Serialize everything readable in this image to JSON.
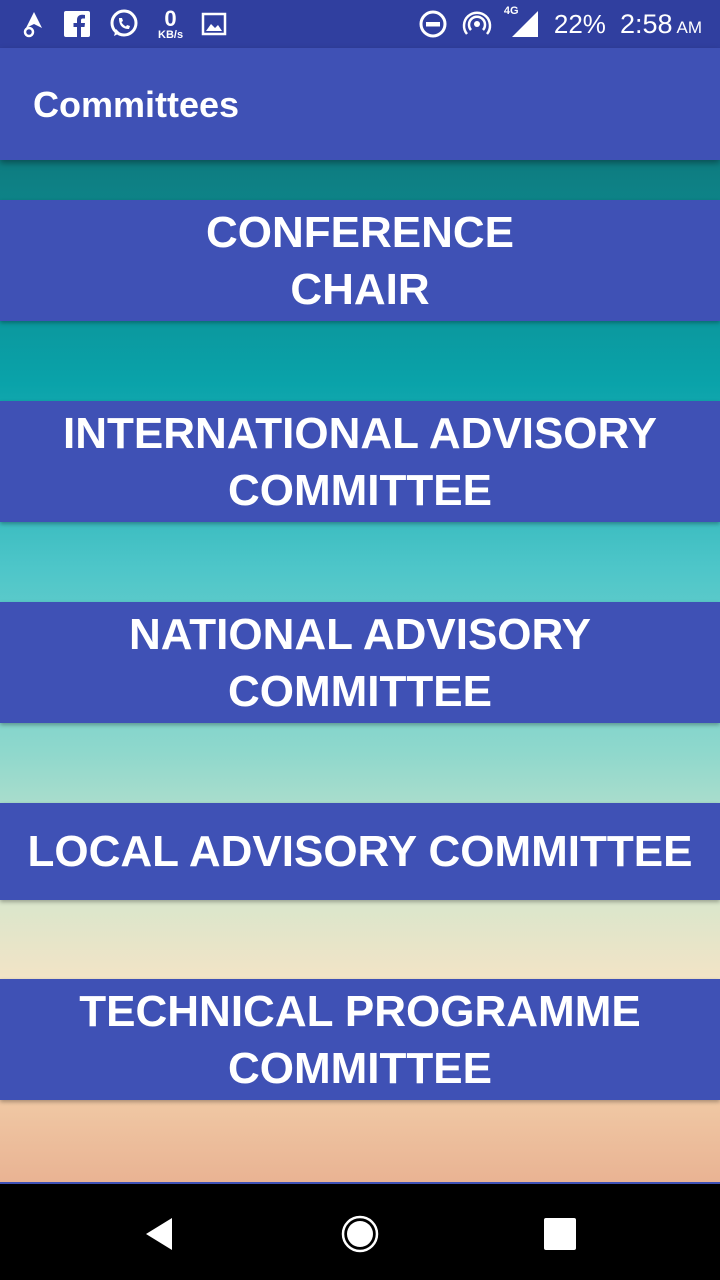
{
  "status_bar": {
    "left_icons": [
      "navigation-icon",
      "facebook-icon",
      "whatsapp-icon",
      "network-speed-icon",
      "gallery-icon"
    ],
    "network_speed_value": "0",
    "network_speed_unit": "KB/s",
    "network_type": "4G",
    "battery": "22%",
    "time": "2:58",
    "ampm": "AM"
  },
  "app_bar": {
    "title": "Committees"
  },
  "committees": [
    {
      "line1": "CONFERENCE",
      "line2": "CHAIR"
    },
    {
      "line1": "INTERNATIONAL ADVISORY",
      "line2": "COMMITTEE"
    },
    {
      "line1": "NATIONAL ADVISORY",
      "line2": "COMMITTEE"
    },
    {
      "line1": "LOCAL ADVISORY COMMITTEE",
      "line2": ""
    },
    {
      "line1": "TECHNICAL PROGRAMME",
      "line2": "COMMITTEE"
    }
  ],
  "nav_bar": {
    "icons": [
      "back-icon",
      "home-icon",
      "recents-icon"
    ]
  },
  "colors": {
    "primary": "#3f51b5",
    "primary_dark": "#303f9f"
  }
}
